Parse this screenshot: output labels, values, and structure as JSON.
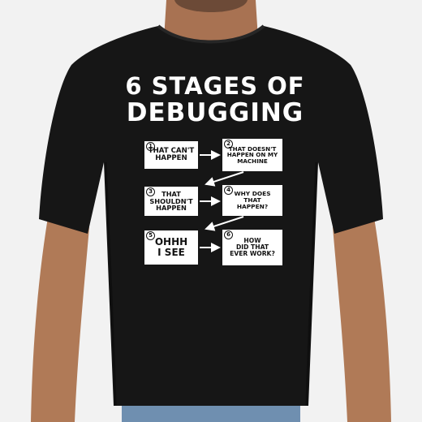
{
  "design": {
    "title_line1": "6 STAGES OF",
    "title_line2": "DEBUGGING",
    "stages": [
      {
        "number": "1",
        "text": "THAT CAN'T\nHAPPEN"
      },
      {
        "number": "2",
        "text": "THAT DOESN'T\nHAPPEN ON MY\nMACHINE"
      },
      {
        "number": "3",
        "text": "THAT\nSHOULDN'T\nHAPPEN"
      },
      {
        "number": "4",
        "text": "WHY DOES\nTHAT\nHAPPEN?"
      },
      {
        "number": "5",
        "text": "OHHH\nI SEE"
      },
      {
        "number": "6",
        "text": "HOW\nDID THAT\nEVER WORK?"
      }
    ]
  },
  "colors": {
    "shirt": "#161616",
    "print": "#ffffff",
    "box_text": "#111111",
    "background": "#f2f2f2",
    "skin": "#b07a57",
    "jeans": "#6f8fb0"
  }
}
